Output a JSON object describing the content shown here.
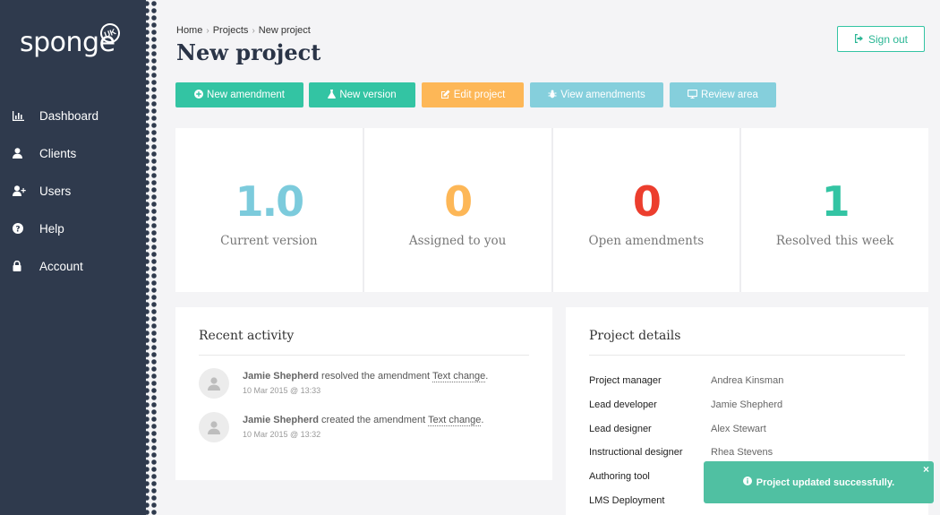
{
  "app": {
    "logo": "sponge",
    "logo_badge": "UK"
  },
  "sidebar": {
    "items": [
      {
        "label": "Dashboard",
        "icon": "bar-chart-icon"
      },
      {
        "label": "Clients",
        "icon": "user-icon"
      },
      {
        "label": "Users",
        "icon": "add-user-icon"
      },
      {
        "label": "Help",
        "icon": "question-circle-icon"
      },
      {
        "label": "Account",
        "icon": "lock-icon"
      }
    ]
  },
  "header": {
    "breadcrumb": [
      "Home",
      "Projects",
      "New project"
    ],
    "title": "New project",
    "signout_label": "Sign out"
  },
  "toolbar": {
    "buttons": [
      {
        "label": "New amendment",
        "icon": "plus-circle-icon",
        "color": "#33c4a3"
      },
      {
        "label": "New version",
        "icon": "flask-icon",
        "color": "#33c4a3"
      },
      {
        "label": "Edit project",
        "icon": "edit-icon",
        "color": "#fdb757"
      },
      {
        "label": "View amendments",
        "icon": "bug-icon",
        "color": "#85cfdc"
      },
      {
        "label": "Review area",
        "icon": "desktop-icon",
        "color": "#85cfdc"
      }
    ]
  },
  "stats": [
    {
      "value": "1.0",
      "label": "Current version",
      "color": "#7ccbdc"
    },
    {
      "value": "0",
      "label": "Assigned to you",
      "color": "#fdb757"
    },
    {
      "value": "0",
      "label": "Open amendments",
      "color": "#ec3e2e"
    },
    {
      "value": "1",
      "label": "Resolved this week",
      "color": "#33c4a3"
    }
  ],
  "activity": {
    "title": "Recent activity",
    "items": [
      {
        "user": "Jamie Shepherd",
        "action": " resolved the amendment ",
        "target": "Text change",
        "suffix": ".",
        "time": "10 Mar 2015 @ 13:33"
      },
      {
        "user": "Jamie Shepherd",
        "action": " created the amendment ",
        "target": "Text change",
        "suffix": ".",
        "time": "10 Mar 2015 @ 13:32"
      }
    ]
  },
  "details": {
    "title": "Project details",
    "rows": [
      {
        "key": "Project manager",
        "value": "Andrea Kinsman"
      },
      {
        "key": "Lead developer",
        "value": "Jamie Shepherd"
      },
      {
        "key": "Lead designer",
        "value": "Alex Stewart"
      },
      {
        "key": "Instructional designer",
        "value": "Rhea Stevens"
      },
      {
        "key": "Authoring tool",
        "value": ""
      },
      {
        "key": "LMS Deployment",
        "value": ""
      }
    ]
  },
  "toast": {
    "message": "Project updated successfully.",
    "close": "×",
    "icon": "info-circle-icon"
  }
}
